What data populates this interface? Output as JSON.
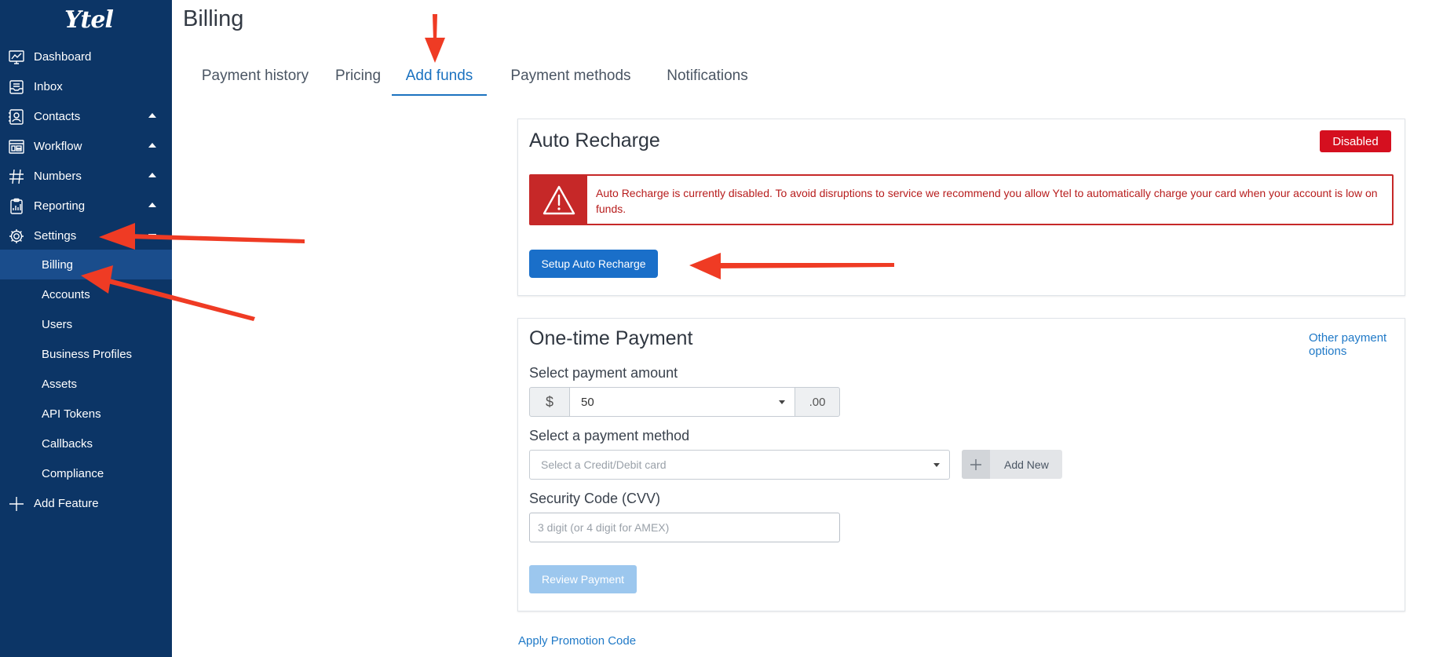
{
  "brand": {
    "logo_text": "Ytel"
  },
  "sidebar": {
    "items": [
      {
        "label": "Dashboard"
      },
      {
        "label": "Inbox"
      },
      {
        "label": "Contacts"
      },
      {
        "label": "Workflow"
      },
      {
        "label": "Numbers"
      },
      {
        "label": "Reporting"
      },
      {
        "label": "Settings"
      }
    ],
    "settings_sub": [
      {
        "label": "Billing"
      },
      {
        "label": "Accounts"
      },
      {
        "label": "Users"
      },
      {
        "label": "Business Profiles"
      },
      {
        "label": "Assets"
      },
      {
        "label": "API Tokens"
      },
      {
        "label": "Callbacks"
      },
      {
        "label": "Compliance"
      }
    ],
    "add_feature": "Add Feature"
  },
  "page": {
    "title": "Billing"
  },
  "tabs": [
    {
      "label": "Payment history"
    },
    {
      "label": "Pricing"
    },
    {
      "label": "Add funds"
    },
    {
      "label": "Payment methods"
    },
    {
      "label": "Notifications"
    }
  ],
  "auto_recharge": {
    "title": "Auto Recharge",
    "status": "Disabled",
    "alert_text": "Auto Recharge is currently disabled. To avoid disruptions to service we recommend you allow Ytel to automatically charge your card when your account is low on funds.",
    "setup_button": "Setup Auto Recharge"
  },
  "one_time": {
    "title": "One-time Payment",
    "other_options": "Other payment options",
    "amount_label": "Select payment amount",
    "currency": "$",
    "amount_value": "50",
    "cents": ".00",
    "method_label": "Select a payment method",
    "method_placeholder": "Select a Credit/Debit card",
    "add_new": "Add New",
    "cvv_label": "Security Code (CVV)",
    "cvv_placeholder": "3 digit (or 4 digit for AMEX)",
    "review_button": "Review Payment"
  },
  "promo_link": "Apply Promotion Code",
  "colors": {
    "sidebar": "#0c3566",
    "accent": "#1a6fc9",
    "danger": "#d50f1f",
    "annotation": "#ef3b24"
  }
}
